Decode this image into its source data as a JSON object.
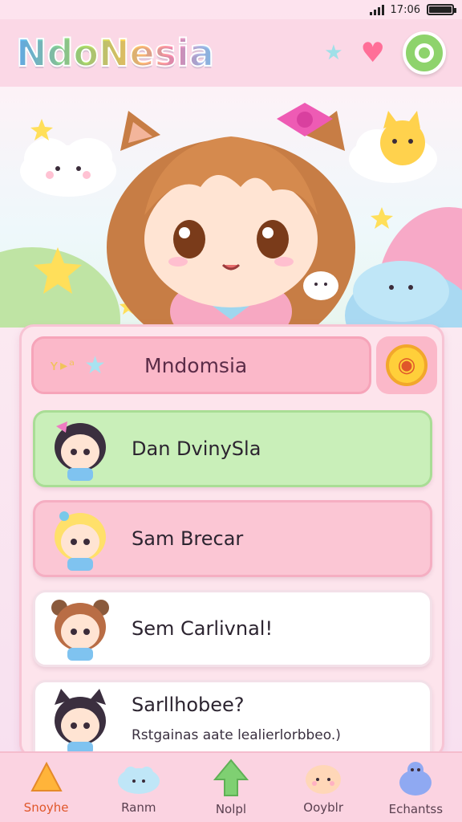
{
  "status_bar": {
    "time": "17:06"
  },
  "header": {
    "app_title": "NdoNesia"
  },
  "search": {
    "deco_text": "ʏ▸ᵃ",
    "value": "Mndomsia"
  },
  "contacts": [
    {
      "name": "Dan DvinySla",
      "color": "#c9efb9"
    },
    {
      "name": "Sam Brecar",
      "color": "#fbc6d4"
    },
    {
      "name": "Sem Carlivnal!",
      "color": "#ffffff"
    },
    {
      "name": "Sarllhobee?",
      "subtitle": "Rstgainas aate lealierlorbbeo.)",
      "color": "#ffffff"
    }
  ],
  "bottom_nav": [
    {
      "label": "Snoyhe",
      "icon": "triangle-home-icon",
      "active": true
    },
    {
      "label": "Ranm",
      "icon": "cloud-face-icon",
      "active": false
    },
    {
      "label": "Nolpl",
      "icon": "green-arrow-icon",
      "active": false
    },
    {
      "label": "Ooyblr",
      "icon": "bun-face-icon",
      "active": false
    },
    {
      "label": "Echantss",
      "icon": "blue-creature-icon",
      "active": false
    }
  ],
  "colors": {
    "header_bg": "#fbd8e6",
    "accent_pink": "#ff6f98",
    "accent_green": "#8ed36c",
    "nav_active": "#e0572a"
  }
}
